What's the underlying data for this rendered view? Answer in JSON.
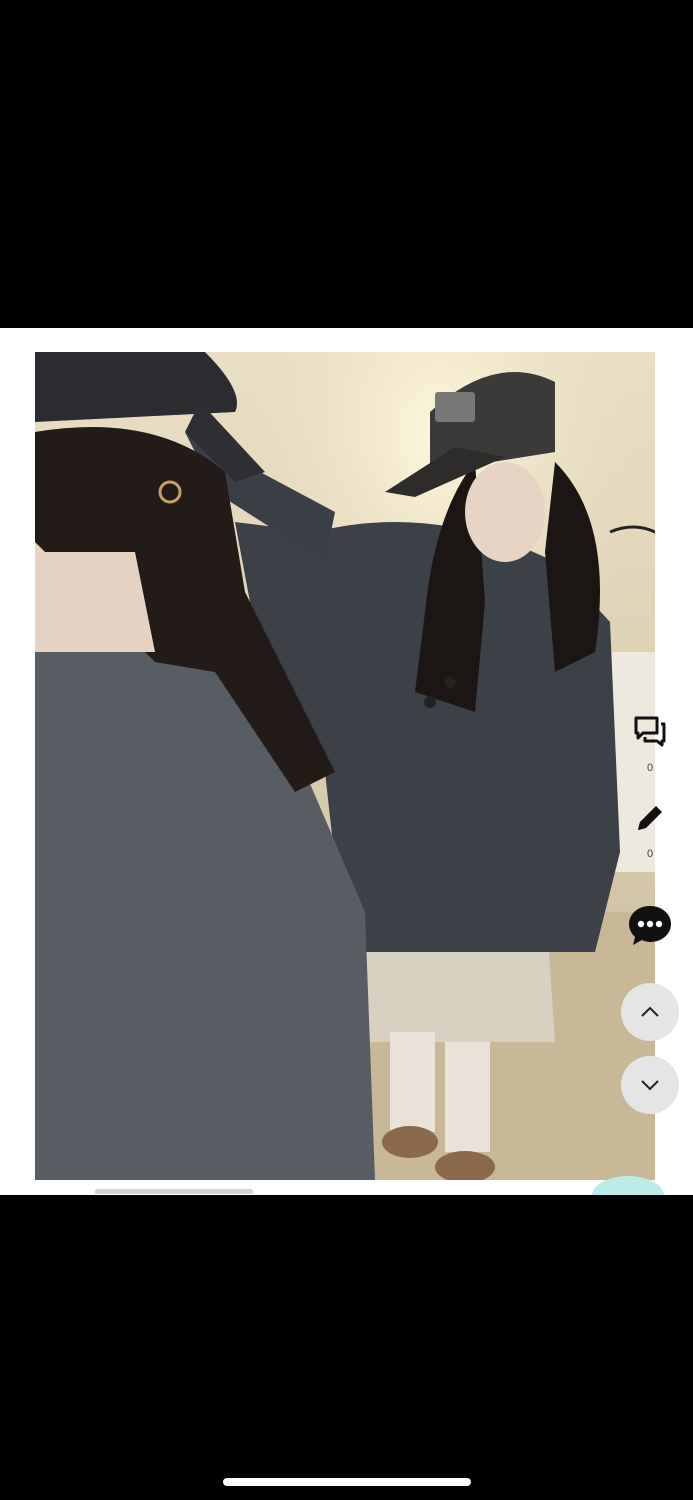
{
  "screen": {
    "photo": {
      "description_alt": ""
    },
    "side_actions": [
      {
        "name": "comments",
        "icon": "chat-bubbles-icon",
        "count": "0"
      },
      {
        "name": "edit",
        "icon": "pencil-icon",
        "count": "0"
      },
      {
        "name": "message",
        "icon": "speech-bubble-dots-icon"
      }
    ],
    "nav": {
      "up_icon": "chevron-up-icon",
      "down_icon": "chevron-down-icon"
    }
  }
}
